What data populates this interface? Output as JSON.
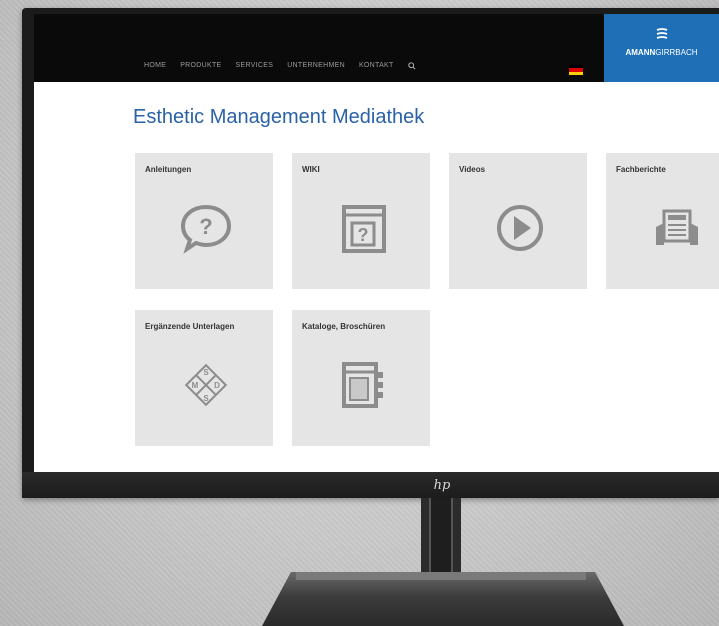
{
  "nav": {
    "items": [
      "HOME",
      "PRODUKTE",
      "SERVICES",
      "UNTERNEHMEN",
      "KONTAKT"
    ],
    "search_icon": "search-icon",
    "flag_colors": [
      "#000000",
      "#dd0000",
      "#ffce00"
    ]
  },
  "brand": {
    "name_bold": "AMANN",
    "name_light": "GIRRBACH",
    "color": "#1f6fb6"
  },
  "page": {
    "title": "Esthetic Management Mediathek"
  },
  "tiles": [
    {
      "label": "Anleitungen",
      "icon": "question-bubble-icon"
    },
    {
      "label": "WIKI",
      "icon": "question-book-icon"
    },
    {
      "label": "Videos",
      "icon": "play-icon"
    },
    {
      "label": "Fachberichte",
      "icon": "newspaper-hands-icon"
    },
    {
      "label": "Ergänzende Unterlagen",
      "icon": "msds-diamond-icon"
    },
    {
      "label": "Kataloge, Broschüren",
      "icon": "catalog-icon"
    }
  ],
  "monitor": {
    "logo": "hp"
  }
}
